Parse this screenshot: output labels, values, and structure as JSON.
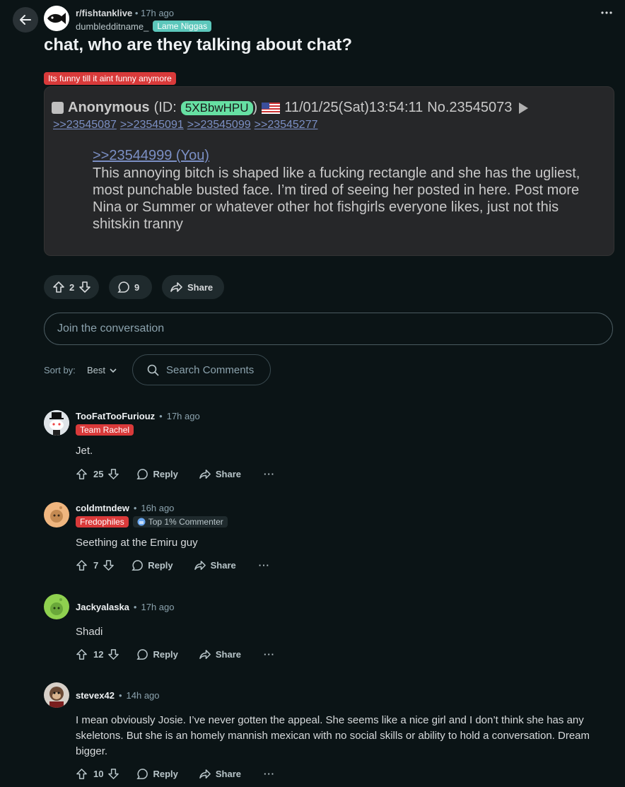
{
  "header": {
    "subreddit": "r/fishtanklive",
    "post_time": "17h ago",
    "separator": "•",
    "username": "dumbledditname_",
    "user_flair": "Lame Niggas"
  },
  "post": {
    "title": "chat, who are they talking about chat?",
    "flair": "Its funny till it aint funny anymore",
    "embed": {
      "name": "Anonymous",
      "id_prefix": "(ID:",
      "id": "5XBbwHPU",
      "id_suffix": ")",
      "datetime": "11/01/25(Sat)13:54:11",
      "number": "No.23545073",
      "replies": [
        ">>23545087",
        ">>23545091",
        ">>23545099",
        ">>23545277"
      ],
      "quote": ">>23544999 (You)",
      "body": "This annoying bitch is shaped like a fucking rectangle and she has the ugliest, most punchable busted face. I’m tired of seeing her posted in here. Post more Nina or Summer or whatever other hot fishgirls everyone likes, just not this shitskin tranny"
    },
    "votes": "2",
    "comments": "9",
    "share_label": "Share"
  },
  "join": {
    "placeholder": "Join the conversation"
  },
  "sort": {
    "label": "Sort by:",
    "value": "Best"
  },
  "search": {
    "placeholder": "Search Comments"
  },
  "comments": [
    {
      "user": "TooFatTooFuriouz",
      "time": "17h ago",
      "flair": "Team Rachel",
      "body": "Jet.",
      "votes": "25",
      "reply": "Reply",
      "share": "Share",
      "more": "···"
    },
    {
      "user": "coldmtndew",
      "time": "16h ago",
      "flair": "Fredophiles",
      "badge": "Top 1% Commenter",
      "body": "Seething at the Emiru guy",
      "votes": "7",
      "reply": "Reply",
      "share": "Share",
      "more": "···"
    },
    {
      "user": "Jackyalaska",
      "time": "17h ago",
      "body": "Shadi",
      "votes": "12",
      "reply": "Reply",
      "share": "Share",
      "more": "···"
    },
    {
      "user": "stevex42",
      "time": "14h ago",
      "body": "I mean obviously Josie. I’ve never gotten the appeal. She seems like a nice girl and I don’t think she has any skeletons. But she is an homely mannish mexican with no social skills or ability to hold a conversation. Dream bigger.",
      "votes": "10",
      "reply": "Reply",
      "share": "Share",
      "more": "···"
    }
  ],
  "icons": {
    "back": "arrow-left-icon",
    "more": "more-horizontal-icon",
    "upvote": "upvote-icon",
    "downvote": "downvote-icon",
    "comment": "comment-bubble-icon",
    "share": "share-arrow-icon",
    "search": "search-icon",
    "chevron": "chevron-down-icon"
  },
  "colors": {
    "background": "#0b1416",
    "flair_red": "#d93a3a",
    "flair_teal": "#5cc7bb",
    "embed_id": "#66e0a3",
    "link": "#7b8fc4"
  }
}
